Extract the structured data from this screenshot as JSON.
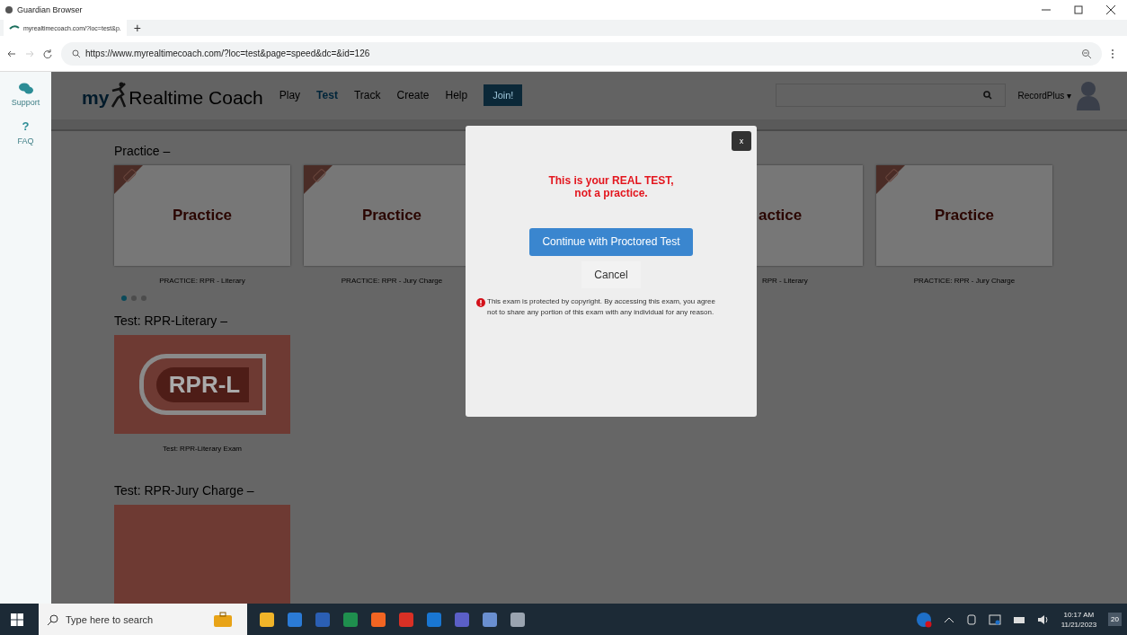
{
  "window": {
    "title": "Guardian Browser"
  },
  "tabs": [
    {
      "label": "myrealtimecoach.com/?loc=test&p.",
      "selected": true
    }
  ],
  "new_tab": "+",
  "address_bar": {
    "url": "https://www.myrealtimecoach.com/?loc=test&page=speed&dc=&id=126"
  },
  "sidebar": {
    "items": [
      {
        "kind": "chat",
        "label": "Support"
      },
      {
        "kind": "glyph",
        "glyph": "?",
        "label": "FAQ"
      }
    ]
  },
  "site": {
    "logo_prefix": "my",
    "logo_name": "Realtime Coach",
    "nav": [
      {
        "label": "Play",
        "selected": false
      },
      {
        "label": "Test",
        "selected": true
      },
      {
        "label": "Track",
        "selected": false
      },
      {
        "label": "Create",
        "selected": false
      },
      {
        "label": "Help",
        "selected": false
      }
    ],
    "join": "Join!",
    "user": "RecordPlus ▾"
  },
  "practice": {
    "heading": "Practice –",
    "cards": [
      {
        "kind": "full",
        "title": "Practice",
        "caption": "PRACTICE: RPR - Literary"
      },
      {
        "kind": "full",
        "title": "Practice",
        "caption": "PRACTICE: RPR - Jury Charge"
      },
      {
        "kind": "partial",
        "title": "actice",
        "caption": "RPR - Literary"
      },
      {
        "kind": "full",
        "title": "Practice",
        "caption": "PRACTICE: RPR - Jury Charge"
      }
    ],
    "dots": [
      {
        "selected": true
      },
      {
        "selected": false
      },
      {
        "selected": false
      }
    ]
  },
  "tests": [
    {
      "heading": "Test: RPR-Literary –",
      "tile": "RPR-L",
      "caption": "Test: RPR-Literary Exam"
    },
    {
      "heading": "Test: RPR-Jury Charge –"
    }
  ],
  "modal": {
    "close": "x",
    "warning": "This is your REAL TEST,\nnot a practice.",
    "primary": "Continue with Proctored Test",
    "secondary": "Cancel",
    "notice": "This exam is protected by copyright. By accessing this exam, you agree not to share any portion of this exam with any individual for any reason."
  },
  "taskbar": {
    "search_placeholder": "Type here to search",
    "time": "10:17 AM",
    "date": "11/21/2023",
    "notifications": "20"
  }
}
